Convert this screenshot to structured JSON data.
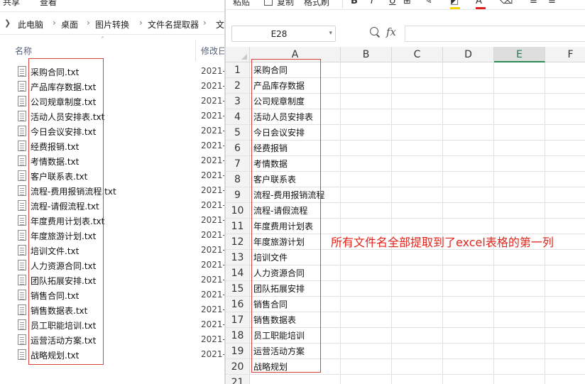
{
  "explorer": {
    "tabs": {
      "share": "共享",
      "view": "查看"
    },
    "breadcrumbs": [
      "此电脑",
      "桌面",
      "图片转换",
      "文件名提取器",
      "文"
    ],
    "columns": {
      "name": "名称",
      "date": "修改日"
    },
    "files": [
      {
        "name": "采购合同.txt",
        "date": "2021-"
      },
      {
        "name": "产品库存数据.txt",
        "date": "2021-"
      },
      {
        "name": "公司规章制度.txt",
        "date": "2021-"
      },
      {
        "name": "活动人员安排表.txt",
        "date": "2021-"
      },
      {
        "name": "今日会议安排.txt",
        "date": "2021-"
      },
      {
        "name": "经费报销.txt",
        "date": "2021-"
      },
      {
        "name": "考情数据.txt",
        "date": "2021-"
      },
      {
        "name": "客户联系表.txt",
        "date": "2021-"
      },
      {
        "name": "流程-费用报销流程.txt",
        "date": "2021-"
      },
      {
        "name": "流程-请假流程.txt",
        "date": "2021-"
      },
      {
        "name": "年度费用计划表.txt",
        "date": "2021-"
      },
      {
        "name": "年度旅游计划.txt",
        "date": "2021-"
      },
      {
        "name": "培训文件.txt",
        "date": "2021-"
      },
      {
        "name": "人力资源合同.txt",
        "date": "2021-"
      },
      {
        "name": "团队拓展安排.txt",
        "date": "2021-"
      },
      {
        "name": "销售合同.txt",
        "date": "2021-"
      },
      {
        "name": "销售数据表.txt",
        "date": "2021-"
      },
      {
        "name": "员工职能培训.txt",
        "date": "2021-"
      },
      {
        "name": "运营活动方案.txt",
        "date": "2021-"
      },
      {
        "name": "战略规划.txt",
        "date": "2021-"
      }
    ]
  },
  "spreadsheet": {
    "ribbon": {
      "paste_label": "粘贴",
      "copy_label": "复制",
      "format_painter_label": "格式刷",
      "bold": "B",
      "italic": "I",
      "underline": "U"
    },
    "namebox": "E28",
    "fx_label": "fx",
    "formula_value": "",
    "columns": [
      "A",
      "B",
      "C",
      "D",
      "E",
      "F"
    ],
    "selected_column": "E",
    "rows": [
      "1",
      "2",
      "3",
      "4",
      "5",
      "6",
      "7",
      "8",
      "9",
      "10",
      "11",
      "12",
      "13",
      "14",
      "15",
      "16",
      "17",
      "18",
      "19",
      "20",
      "21"
    ],
    "column_a": [
      "采购合同",
      "产品库存数据",
      "公司规章制度",
      "活动人员安排表",
      "今日会议安排",
      "经费报销",
      "考情数据",
      "客户联系表",
      "流程-费用报销流程",
      "流程-请假流程",
      "年度费用计划表",
      "年度旅游计划",
      "培训文件",
      "人力资源合同",
      "团队拓展安排",
      "销售合同",
      "销售数据表",
      "员工职能培训",
      "运营活动方案",
      "战略规划"
    ]
  },
  "annotation": "所有文件名全部提取到了excel表格的第一列",
  "colors": {
    "highlight_border": "#d9413b",
    "annotation_text": "#e2231a",
    "selected_column_accent": "#2b8a57"
  }
}
